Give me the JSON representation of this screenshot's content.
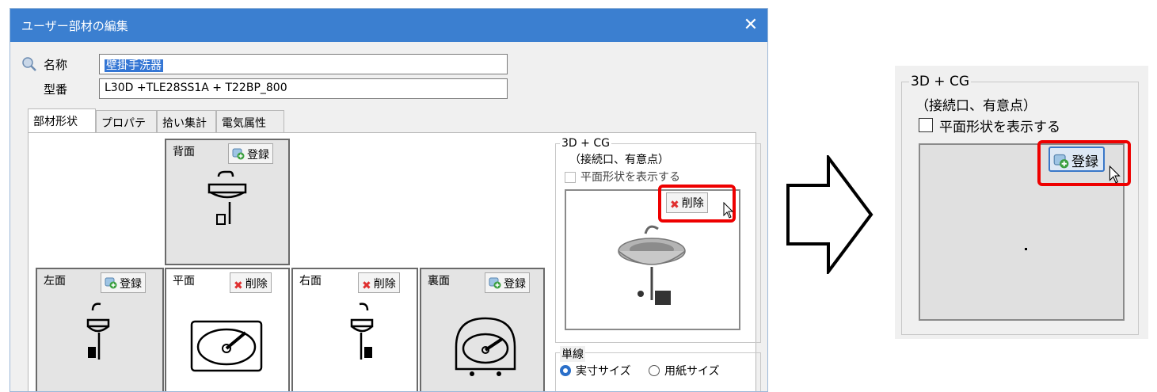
{
  "dialog": {
    "title": "ユーザー部材の編集",
    "close_glyph": "✕",
    "name_label": "名称",
    "name_value": "壁掛手洗器",
    "model_label": "型番",
    "model_value": "L30D +TLE28SS1A + T22BP_800",
    "tabs": [
      "部材形状",
      "プロパティ",
      "拾い集計",
      "電気属性"
    ],
    "views": {
      "back": {
        "label": "背面",
        "button": "登録"
      },
      "left": {
        "label": "左面",
        "button": "登録"
      },
      "plan": {
        "label": "平面",
        "button": "削除"
      },
      "right": {
        "label": "右面",
        "button": "削除"
      },
      "rear": {
        "label": "裏面",
        "button": "登録"
      }
    },
    "cg_group": {
      "title": "3D + CG",
      "subtitle": "（接続口、有意点）",
      "checkbox_label": "平面形状を表示する",
      "delete_button": "削除"
    },
    "line_group": {
      "title": "単線",
      "radio_actual": "実寸サイズ",
      "radio_paper": "用紙サイズ"
    }
  },
  "zoom": {
    "title": "3D + CG",
    "subtitle": "（接続口、有意点）",
    "checkbox_label": "平面形状を表示する",
    "register_button": "登録"
  },
  "colors": {
    "titlebar": "#3b7fd0",
    "highlight": "#e00000",
    "selection": "#3476d4"
  }
}
